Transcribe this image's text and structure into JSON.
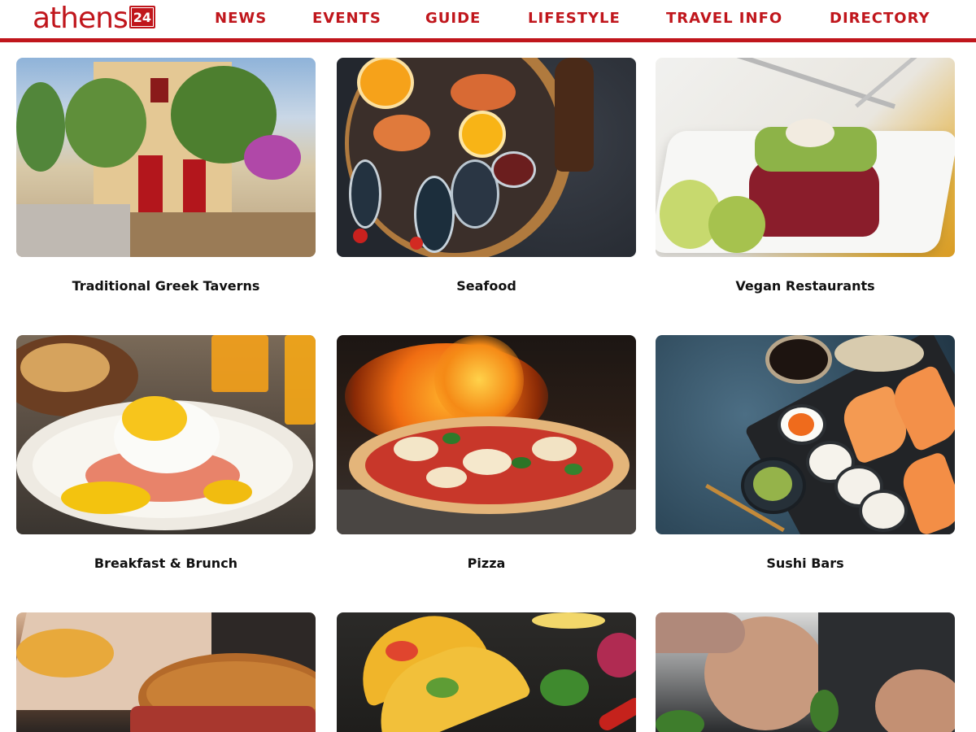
{
  "brand": {
    "name": "athens",
    "number": "24"
  },
  "nav": {
    "items": [
      {
        "label": "NEWS"
      },
      {
        "label": "EVENTS"
      },
      {
        "label": "GUIDE"
      },
      {
        "label": "LIFESTYLE"
      },
      {
        "label": "TRAVEL INFO"
      },
      {
        "label": "DIRECTORY"
      }
    ]
  },
  "cards": [
    {
      "title": "Traditional Greek Taverns"
    },
    {
      "title": "Seafood"
    },
    {
      "title": "Vegan Restaurants"
    },
    {
      "title": "Breakfast & Brunch"
    },
    {
      "title": "Pizza"
    },
    {
      "title": "Sushi Bars"
    },
    {
      "title": ""
    },
    {
      "title": ""
    },
    {
      "title": ""
    }
  ],
  "colors": {
    "accent": "#c0161c"
  }
}
